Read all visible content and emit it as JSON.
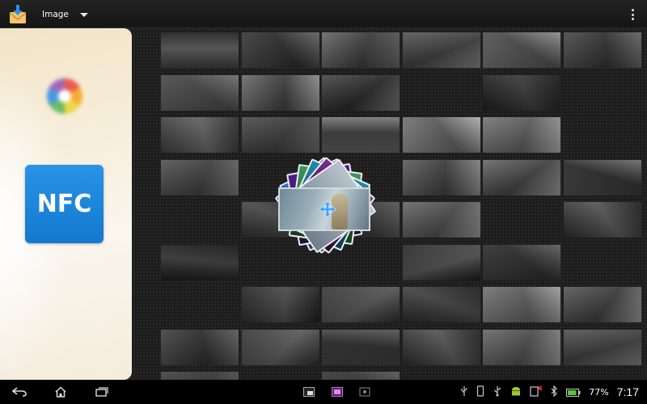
{
  "action_bar": {
    "app_icon": "share-download-icon",
    "spinner_label": "Image",
    "spinner_icon": "chevron-down-icon",
    "overflow_icon": "overflow-menu-icon"
  },
  "share_panel": {
    "targets": [
      {
        "name": "picasa",
        "icon": "picasa-icon"
      },
      {
        "name": "nfc",
        "icon": "nfc-icon",
        "label": "NFC"
      }
    ]
  },
  "drag_stack": {
    "move_icon": "move-arrows-icon"
  },
  "gallery": {
    "thumbnails": [
      {
        "r": 0,
        "c": 0,
        "pal": "#3c3c3c,#575757,#1e1e1e"
      },
      {
        "r": 0,
        "c": 1,
        "pal": "#484848,#2a2a2a,#606060"
      },
      {
        "r": 0,
        "c": 2,
        "pal": "#6a6a6a,#393939,#5a5a5a"
      },
      {
        "r": 0,
        "c": 3,
        "pal": "#5a5a5a,#3b3b3b,#7a7a7a"
      },
      {
        "r": 0,
        "c": 4,
        "pal": "#6e6e6e,#4a4a4a,#8a8a8a"
      },
      {
        "r": 0,
        "c": 5,
        "pal": "#4d4d4d,#2f2f2f,#5f5f5f"
      },
      {
        "r": 1,
        "c": 0,
        "pal": "#5a5a5a,#444,#6a6a6a"
      },
      {
        "r": 1,
        "c": 1,
        "pal": "#6d6d6d,#3a3a3a,#888"
      },
      {
        "r": 1,
        "c": 2,
        "pal": "#4a4a4a,#262626,#6a6a6a"
      },
      {
        "r": 1,
        "c": 4,
        "pal": "#1e1e1e,#3a3a3a,#161616"
      },
      {
        "r": 2,
        "c": 0,
        "pal": "#3b3b3b,#626262,#2a2a2a"
      },
      {
        "r": 2,
        "c": 1,
        "pal": "#4e4e4e,#3a3a3a,#5f5f5f"
      },
      {
        "r": 2,
        "c": 2,
        "pal": "#5a5a5a,#3a3a3a,#777"
      },
      {
        "r": 2,
        "c": 3,
        "pal": "#8a8a8a,#5a5a5a,#aaa"
      },
      {
        "r": 2,
        "c": 4,
        "pal": "#777,#5a5a5a,#999"
      },
      {
        "r": 3,
        "c": 0,
        "pal": "#555,#3d3d3d,#6a6a6a"
      },
      {
        "r": 3,
        "c": 3,
        "pal": "#5f5f5f,#3a3a3a,#7d7d7d"
      },
      {
        "r": 3,
        "c": 4,
        "pal": "#6a6a6a,#3f3f3f,#8a8a8a"
      },
      {
        "r": 3,
        "c": 5,
        "pal": "#4a4a4a,#2a2a2a,#6b6b6b"
      },
      {
        "r": 4,
        "c": 1,
        "pal": "#2f2f2f,#4a4a4a,#1f1f1f"
      },
      {
        "r": 4,
        "c": 2,
        "pal": "#444,#333,#555"
      },
      {
        "r": 4,
        "c": 3,
        "pal": "#6a6a6a,#4a4a4a,#888"
      },
      {
        "r": 4,
        "c": 5,
        "pal": "#2a2a2a,#555,#1a1a1a"
      },
      {
        "r": 5,
        "c": 0,
        "pal": "#1a1a1a,#3a3a3a,#111"
      },
      {
        "r": 5,
        "c": 3,
        "pal": "#2a2a2a,#505050,#1a1a1a"
      },
      {
        "r": 5,
        "c": 4,
        "pal": "#3a3a3a,#2a2a2a,#5a5a5a"
      },
      {
        "r": 6,
        "c": 1,
        "pal": "#2a2a2a,#4a4a4a,#1b1b1b"
      },
      {
        "r": 6,
        "c": 2,
        "pal": "#3a3a3a,#555,#2a2a2a"
      },
      {
        "r": 6,
        "c": 3,
        "pal": "#2a2a2a,#444,#1a1a1a"
      },
      {
        "r": 6,
        "c": 4,
        "pal": "#7a7a7a,#5a5a5a,#999"
      },
      {
        "r": 6,
        "c": 5,
        "pal": "#5a5a5a,#3a3a3a,#888"
      },
      {
        "r": 7,
        "c": 0,
        "pal": "#4a4a4a,#2a2a2a,#5a5a5a"
      },
      {
        "r": 7,
        "c": 1,
        "pal": "#3a3a3a,#5a5a5a,#2a2a2a"
      },
      {
        "r": 7,
        "c": 2,
        "pal": "#3f3f3f,#2a2a2a,#555"
      },
      {
        "r": 7,
        "c": 3,
        "pal": "#2a2a2a,#555,#1f1f1f"
      },
      {
        "r": 7,
        "c": 4,
        "pal": "#6a6a6a,#4a4a4a,#888"
      },
      {
        "r": 7,
        "c": 5,
        "pal": "#555,#3a3a3a,#777"
      },
      {
        "r": 8,
        "c": 0,
        "pal": "#444,#333,#555"
      },
      {
        "r": 8,
        "c": 2,
        "pal": "#444,#333,#555"
      }
    ]
  },
  "nav_bar": {
    "back_icon": "back-icon",
    "home_icon": "home-icon",
    "recent_icon": "recent-apps-icon",
    "status": {
      "battery_percent": "77%",
      "time": "7:17"
    }
  }
}
